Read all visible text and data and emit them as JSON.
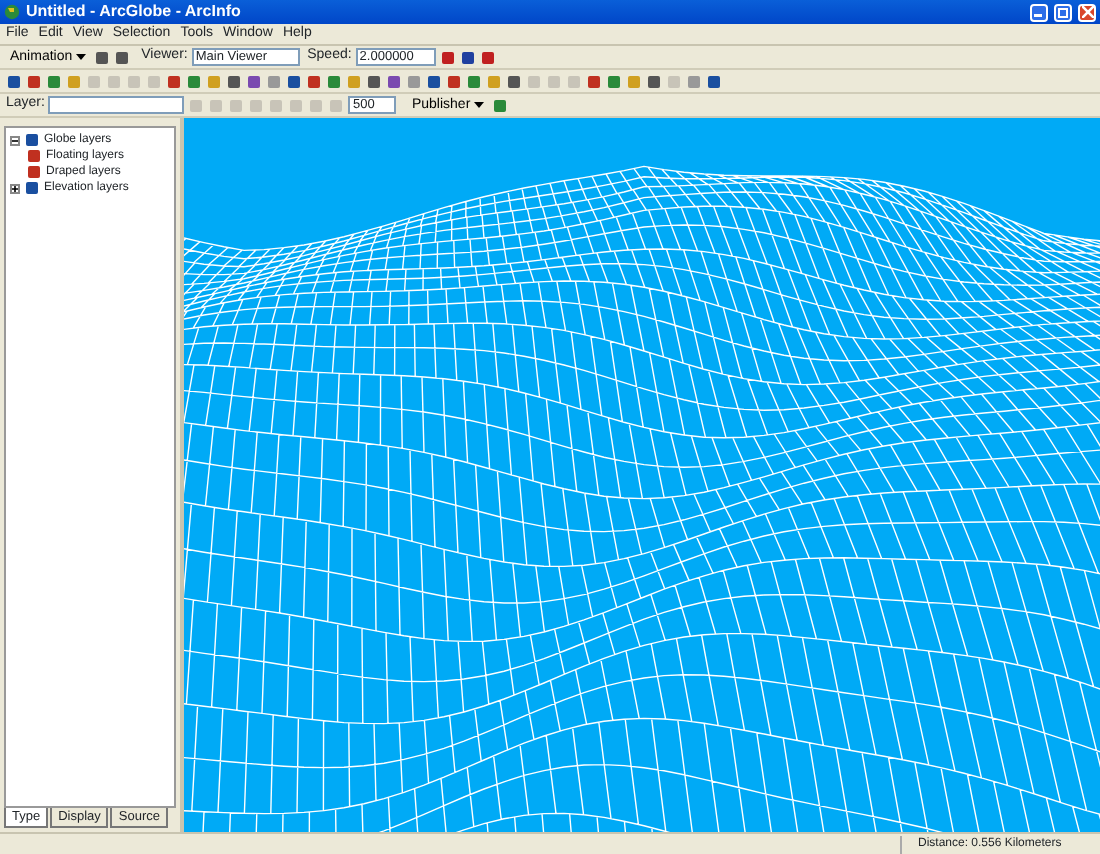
{
  "window": {
    "title": "Untitled - ArcGlobe - ArcInfo"
  },
  "menu": [
    "File",
    "Edit",
    "View",
    "Selection",
    "Tools",
    "Window",
    "Help"
  ],
  "animation_toolbar": {
    "animation": "Animation",
    "viewer_label": "Viewer:",
    "viewer_value": "Main Viewer",
    "speed_label": "Speed:",
    "speed_value": "2.000000"
  },
  "layer_toolbar": {
    "layer_label": "Layer:",
    "scale_value": "500",
    "publisher": "Publisher"
  },
  "table_of_contents": {
    "items": [
      {
        "label": "Globe layers",
        "expanded": true,
        "children": [
          {
            "label": "Floating layers"
          },
          {
            "label": "Draped layers"
          }
        ]
      },
      {
        "label": "Elevation layers",
        "expanded": false
      }
    ]
  },
  "tabs": [
    {
      "label": "Type",
      "selected": true
    },
    {
      "label": "Display",
      "selected": false
    },
    {
      "label": "Source",
      "selected": false
    }
  ],
  "status_bar": {
    "distance": "Distance:  0.556 Kilometers"
  }
}
